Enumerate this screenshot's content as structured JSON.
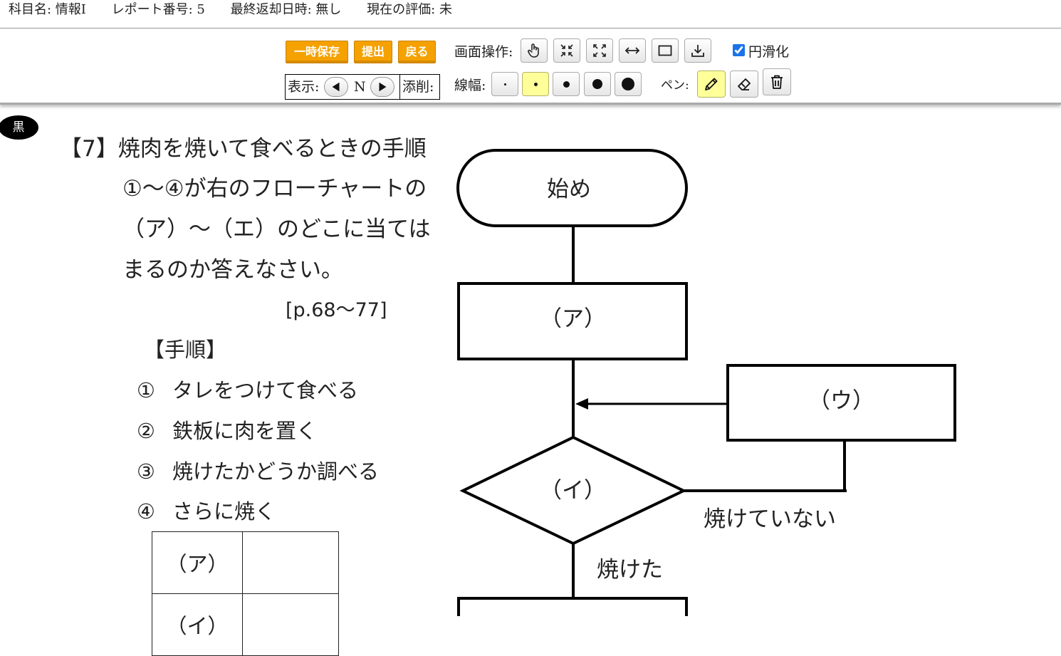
{
  "meta": {
    "subject": "科目名: 情報Ⅰ",
    "report": "レポート番号: 5",
    "returned": "最終返却日時: 無し",
    "evaluation": "現在の評価: 未"
  },
  "toolbar": {
    "save_label": "一時保存",
    "submit_label": "提出",
    "back_label": "戻る",
    "screen_ops_label": "画面操作:",
    "smooth_label": "円滑化",
    "smooth_checked": true,
    "view_label": "表示:",
    "view_page": "N",
    "correction_label": "添削:",
    "linewidth_label": "線幅:",
    "pen_label": "ペン:",
    "screen_icons": [
      "hand-pointer-icon",
      "shrink-icon",
      "expand-icon",
      "fit-width-icon",
      "fit-page-icon",
      "download-icon"
    ],
    "line_widths": [
      1,
      2,
      3,
      4,
      5
    ],
    "selected_line_width": 2,
    "pen_tools": [
      "pencil-icon",
      "eraser-icon",
      "trash-icon"
    ],
    "selected_pen_tool": "pencil-icon"
  },
  "color_badge": "黒",
  "question": {
    "lines": [
      "【7】焼肉を焼いて食べるときの手順",
      "①～④が右のフローチャートの",
      "（ア）～（エ）のどこに当ては",
      "まるのか答えなさい。"
    ],
    "page_ref": "[p.68～77]",
    "steps_title": "【手順】",
    "steps": [
      {
        "num": "①",
        "text": "タレをつけて食べる"
      },
      {
        "num": "②",
        "text": "鉄板に肉を置く"
      },
      {
        "num": "③",
        "text": "焼けたかどうか調べる"
      },
      {
        "num": "④",
        "text": "さらに焼く"
      }
    ],
    "answer_rows": [
      {
        "key": "（ア）",
        "value": ""
      },
      {
        "key": "（イ）",
        "value": ""
      }
    ]
  },
  "flowchart": {
    "start": "始め",
    "box_a": "（ア）",
    "diamond_i": "（イ）",
    "box_u": "（ウ）",
    "not_done": "焼けていない",
    "done": "焼けた"
  }
}
